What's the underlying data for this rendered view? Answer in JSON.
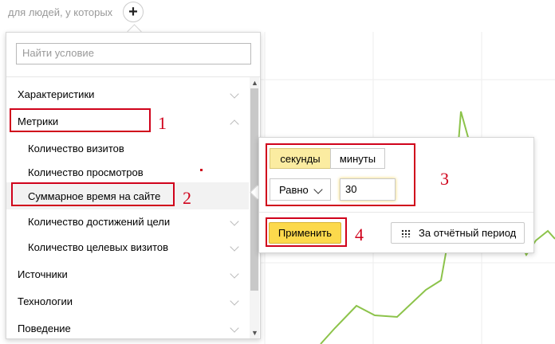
{
  "header": {
    "label": "для людей, у которых",
    "add_symbol": "+"
  },
  "search": {
    "placeholder": "Найти условие"
  },
  "list": [
    {
      "label": "Характеристики",
      "level": "top",
      "chevron": "down"
    },
    {
      "label": "Метрики",
      "level": "top",
      "chevron": "up"
    },
    {
      "label": "Количество визитов",
      "level": "sub"
    },
    {
      "label": "Количество просмотров",
      "level": "sub"
    },
    {
      "label": "Суммарное время на сайте",
      "level": "sub",
      "selected": true
    },
    {
      "label": "Количество достижений цели",
      "level": "sub",
      "chevron": "down"
    },
    {
      "label": "Количество целевых визитов",
      "level": "sub",
      "chevron": "down"
    },
    {
      "label": "Источники",
      "level": "top",
      "chevron": "down"
    },
    {
      "label": "Технологии",
      "level": "top",
      "chevron": "down"
    },
    {
      "label": "Поведение",
      "level": "top",
      "chevron": "down"
    }
  ],
  "popup": {
    "units": [
      {
        "label": "секунды",
        "active": true
      },
      {
        "label": "минуты",
        "active": false
      }
    ],
    "operator": "Равно",
    "value": "30",
    "apply_label": "Применить",
    "period_label": "За отчётный период"
  },
  "annotations": [
    "1",
    "2",
    "3",
    "4"
  ],
  "colors": {
    "annotation": "#d0021b",
    "accent": "#fcd94c",
    "active_segment": "#fbeca1",
    "graph_line": "#8cc34a"
  }
}
